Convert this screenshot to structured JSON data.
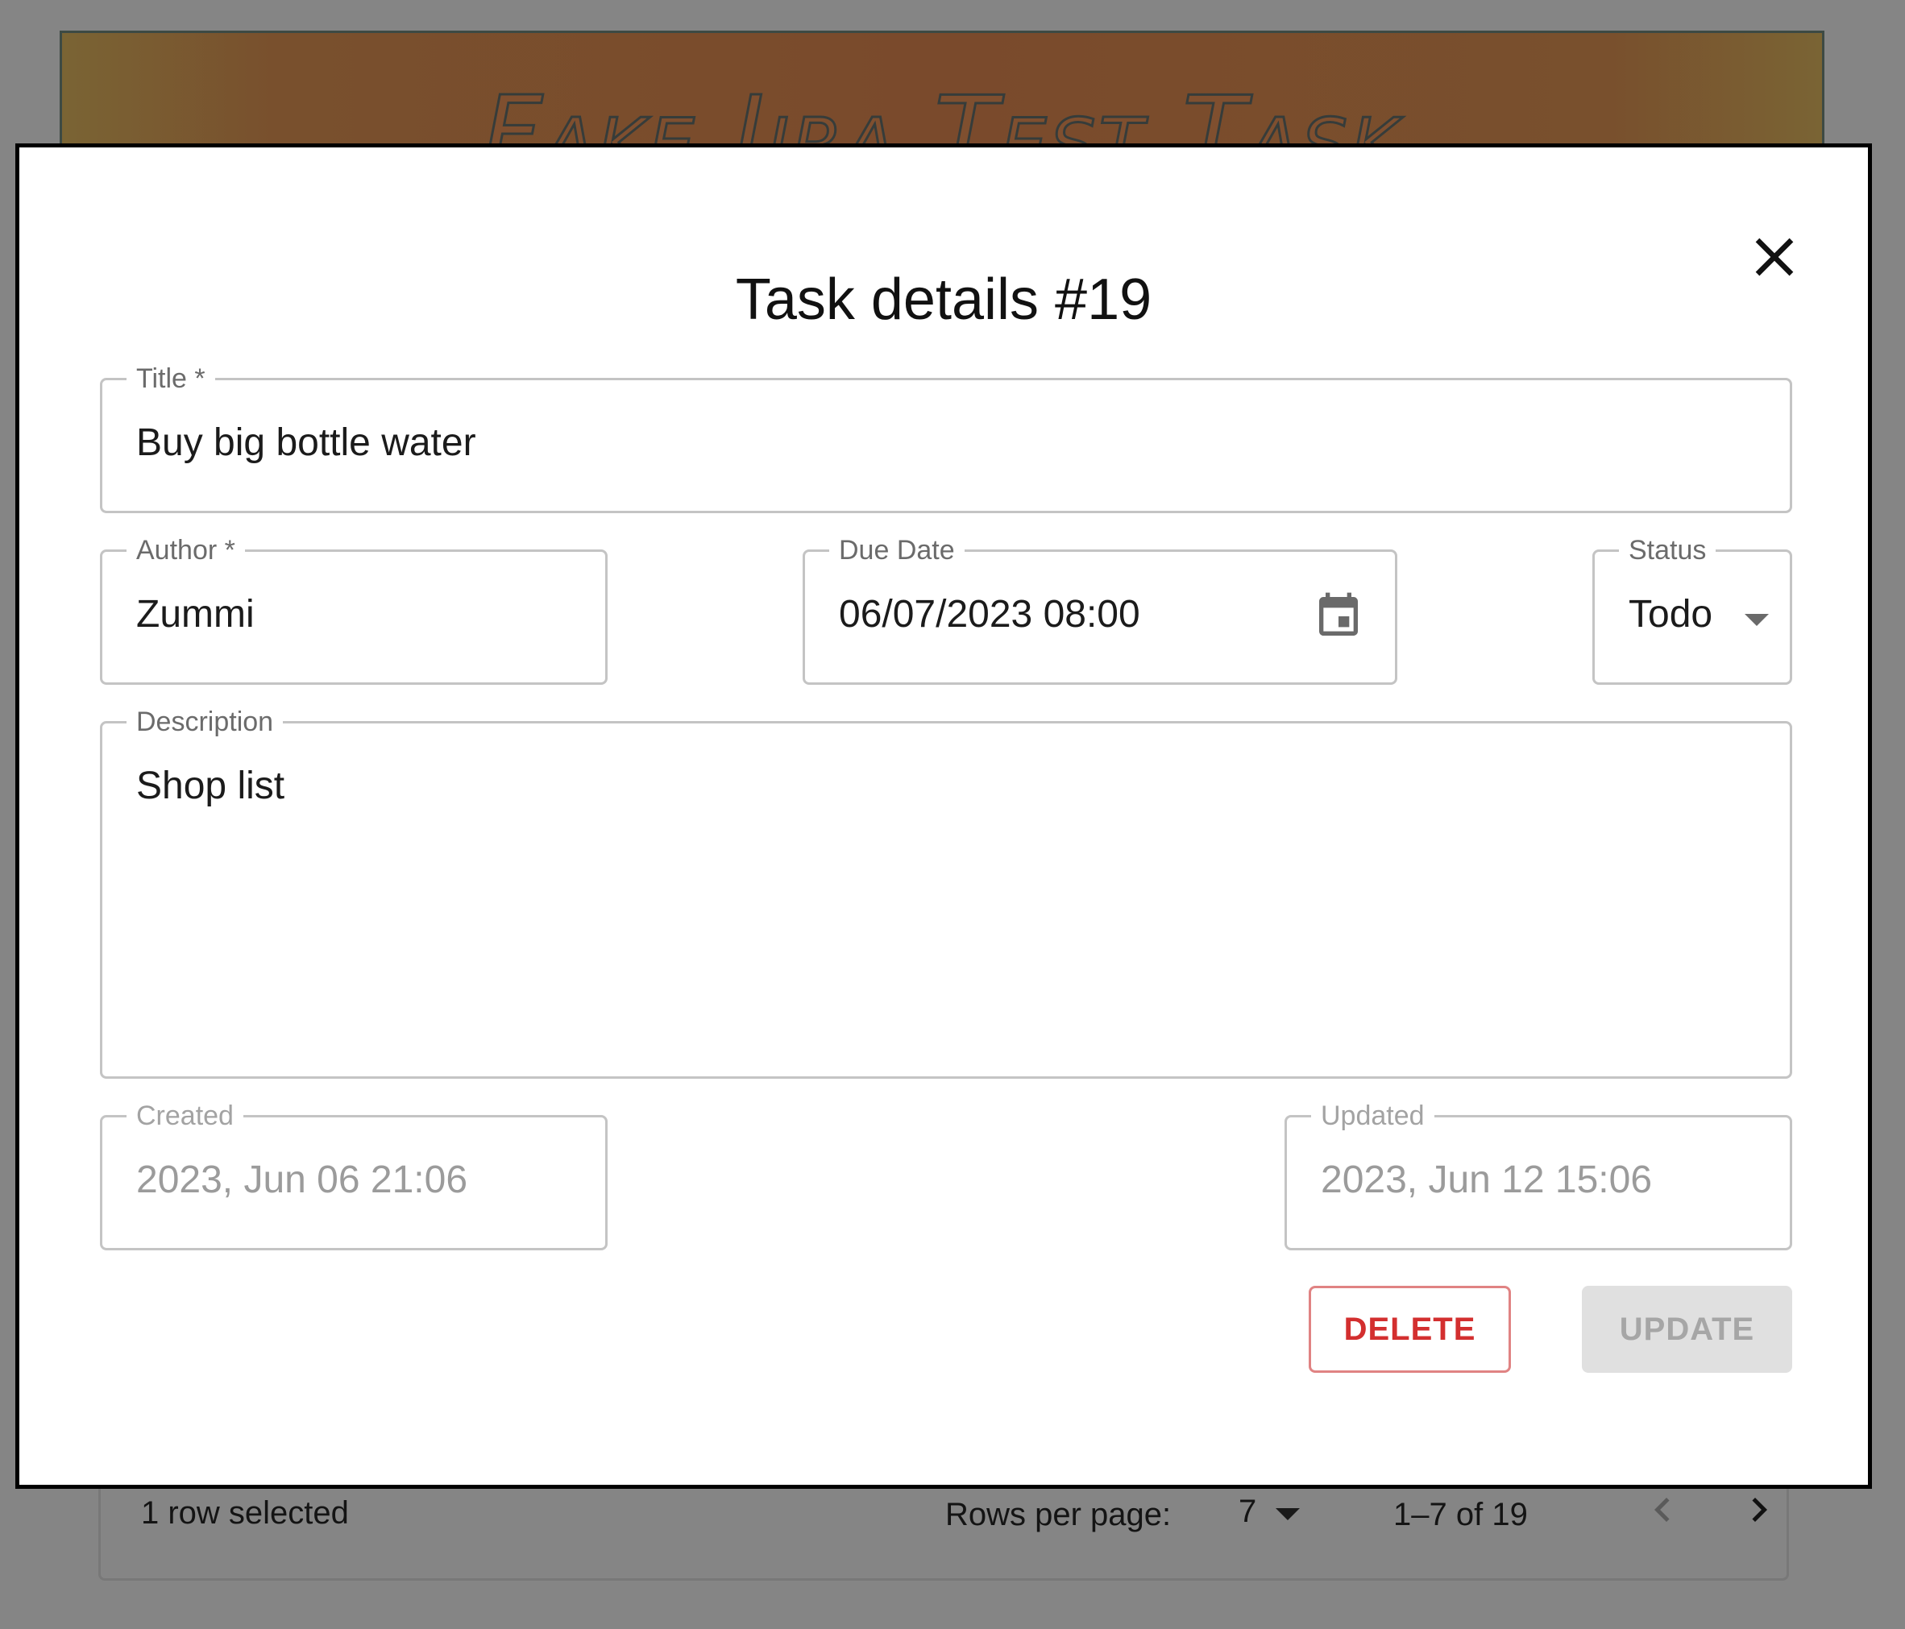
{
  "app": {
    "title": "Fake Jira Test Task"
  },
  "table_footer": {
    "selection_text": "1 row selected",
    "rows_per_page_label": "Rows per page:",
    "rows_per_page_value": "7",
    "range_text": "1–7 of 19",
    "prev_icon": "chevron-left-icon",
    "next_icon": "chevron-right-icon"
  },
  "modal": {
    "title": "Task details #19",
    "close_icon": "close-icon",
    "fields": {
      "title": {
        "label": "Title *",
        "value": "Buy big bottle water"
      },
      "author": {
        "label": "Author *",
        "value": "Zummi"
      },
      "due_date": {
        "label": "Due Date",
        "value": "06/07/2023 08:00",
        "icon": "calendar-icon"
      },
      "status": {
        "label": "Status",
        "value": "Todo"
      },
      "description": {
        "label": "Description",
        "value": "Shop list"
      },
      "created": {
        "label": "Created",
        "value": "2023, Jun 06 21:06"
      },
      "updated": {
        "label": "Updated",
        "value": "2023, Jun 12 15:06"
      }
    },
    "buttons": {
      "delete": "DELETE",
      "update": "UPDATE"
    }
  },
  "colors": {
    "backdrop": "#858585",
    "delete_accent": "#d32f2f",
    "disabled_button_bg": "#e0e0e0",
    "field_border": "#c4c4c4"
  }
}
